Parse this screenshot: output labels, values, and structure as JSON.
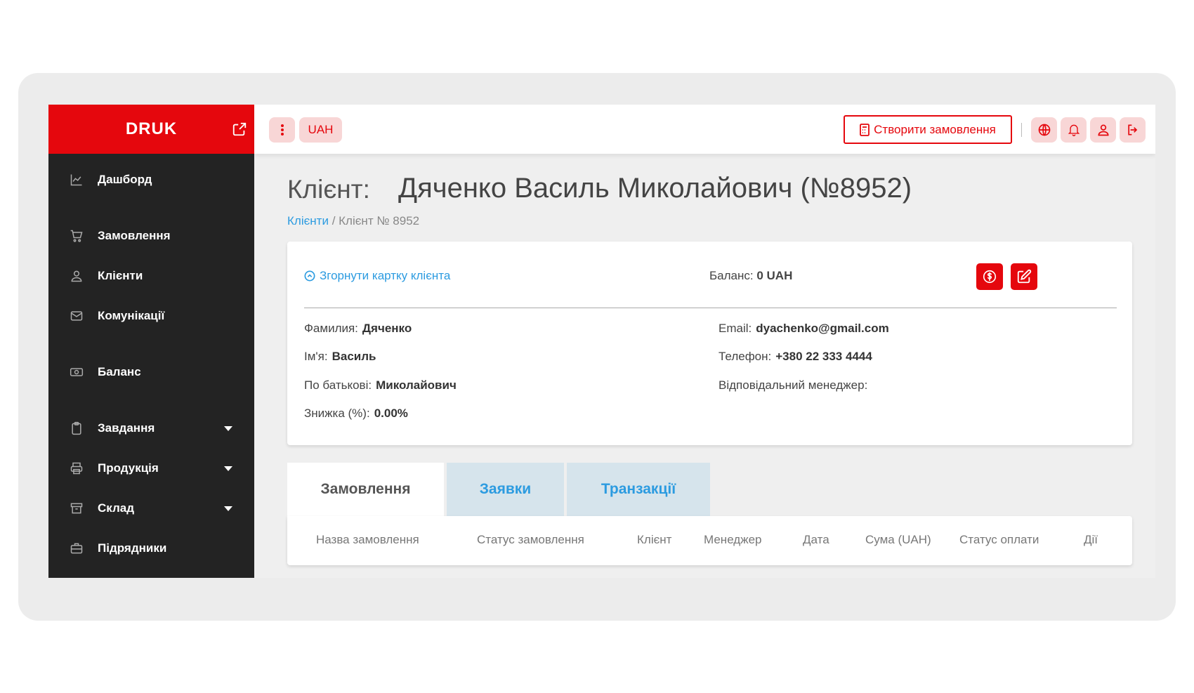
{
  "brand": {
    "name": "DRUK",
    "accent": "#e5070d"
  },
  "sidebar": {
    "items": [
      {
        "label": "Дашборд",
        "icon": "chart-icon",
        "dropdown": false
      },
      {
        "label": "Замовлення",
        "icon": "cart-icon",
        "dropdown": false
      },
      {
        "label": "Клієнти",
        "icon": "user-icon",
        "dropdown": false
      },
      {
        "label": "Комунікації",
        "icon": "mail-icon",
        "dropdown": false
      },
      {
        "label": "Баланс",
        "icon": "money-icon",
        "dropdown": false
      },
      {
        "label": "Завдання",
        "icon": "clipboard-icon",
        "dropdown": true
      },
      {
        "label": "Продукція",
        "icon": "printer-icon",
        "dropdown": true
      },
      {
        "label": "Склад",
        "icon": "archive-icon",
        "dropdown": true
      },
      {
        "label": "Підрядники",
        "icon": "briefcase-icon",
        "dropdown": false
      }
    ]
  },
  "topbar": {
    "menu_icon": "kebab-icon",
    "currency": "UAH",
    "create_order_label": "Створити замовлення",
    "icons": [
      "globe-icon",
      "bell-icon",
      "user-icon",
      "logout-icon"
    ]
  },
  "page": {
    "title_label": "Клієнт:",
    "title_name": "Дяченко Василь Миколайович (№8952)",
    "breadcrumb_link": "Клієнти",
    "breadcrumb_sep": "/",
    "breadcrumb_current": "Клієнт № 8952"
  },
  "card": {
    "collapse_label": "Згорнути картку клієнта",
    "balance_label": "Баланс:",
    "balance_value": "0 UAH",
    "fields_left": [
      {
        "label": "Фамилия:",
        "value": "Дяченко"
      },
      {
        "label": "Ім'я:",
        "value": "Василь"
      },
      {
        "label": "По батькові:",
        "value": "Миколайович"
      },
      {
        "label": "Знижка (%):",
        "value": "0.00%"
      }
    ],
    "fields_right": [
      {
        "label": "Email:",
        "value": "dyachenko@gmail.com"
      },
      {
        "label": "Телефон:",
        "value": "+380 22 333 4444"
      },
      {
        "label": "Відповідальний менеджер:",
        "value": ""
      }
    ]
  },
  "tabs": [
    "Замовлення",
    "Заявки",
    "Транзакції"
  ],
  "table": {
    "headers": [
      "Назва замовлення",
      "Статус замовлення",
      "Клієнт",
      "Менеджер",
      "Дата",
      "Сума (UAH)",
      "Статус оплати",
      "Дії"
    ]
  }
}
